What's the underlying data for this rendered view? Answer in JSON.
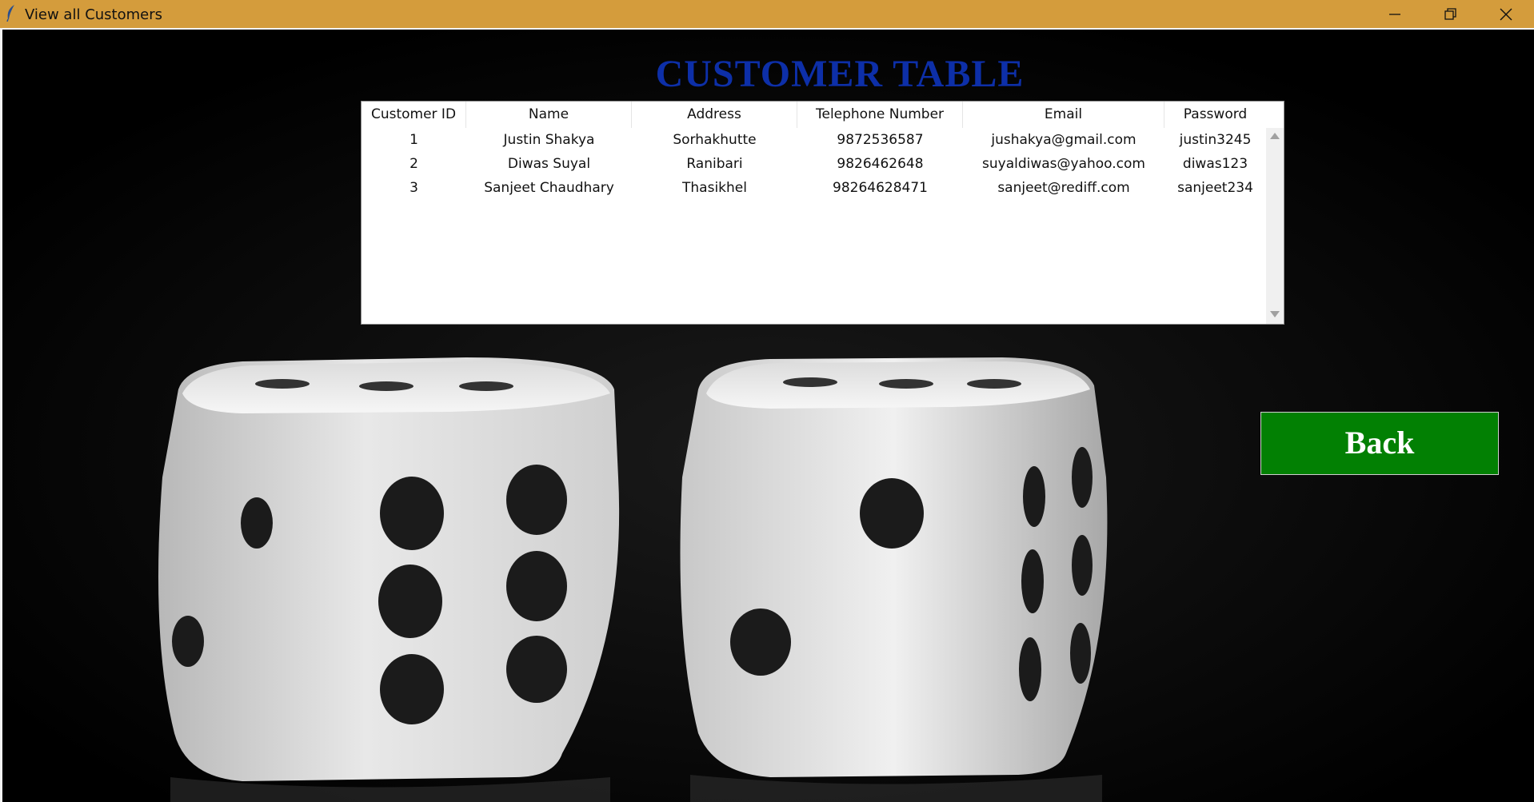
{
  "window": {
    "title": "View all Customers",
    "controls": [
      "minimize-icon",
      "restore-icon",
      "close-icon"
    ]
  },
  "colors": {
    "titlebar": "#d49c3c",
    "title_text": "#0d2fa8",
    "back_button": "#028003",
    "background": "#000000"
  },
  "page": {
    "title": "CUSTOMER TABLE",
    "back_label": "Back"
  },
  "table": {
    "columns": [
      "Customer ID",
      "Name",
      "Address",
      "Telephone Number",
      "Email",
      "Password"
    ],
    "rows": [
      [
        "1",
        "Justin Shakya",
        "Sorhakhutte",
        "9872536587",
        "jushakya@gmail.com",
        "justin3245"
      ],
      [
        "2",
        "Diwas Suyal",
        "Ranibari",
        "9826462648",
        "suyaldiwas@yahoo.com",
        "diwas123"
      ],
      [
        "3",
        "Sanjeet Chaudhary",
        "Thasikhel",
        "98264628471",
        "sanjeet@rediff.com",
        "sanjeet234"
      ]
    ]
  }
}
